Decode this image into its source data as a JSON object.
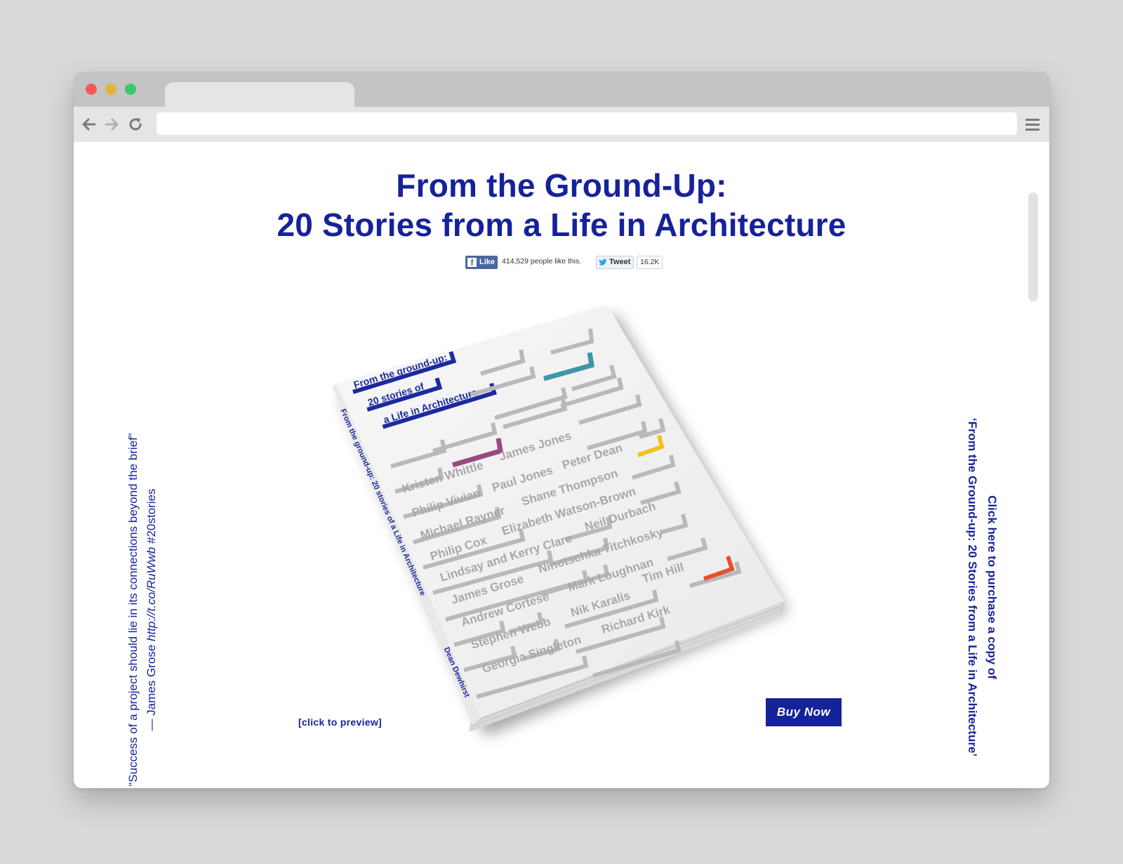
{
  "page": {
    "title_line1": "From the Ground-Up:",
    "title_line2": "20 Stories from a Life in Architecture"
  },
  "social": {
    "fb_label": "Like",
    "fb_count_text": "414,529 people like this.",
    "tweet_label": "Tweet",
    "tweet_count": "16.2K"
  },
  "quote": {
    "text": "“Success of a project should lie in its connections beyond the brief”",
    "attribution": "— James Grose",
    "link": "http://t.co/RuWwb",
    "hashtag": "#20stories"
  },
  "purchase": {
    "line1": "Click here to purchase a copy of",
    "line2": "‘From the Ground-up: 20 Stories from a Life in Architecture’"
  },
  "book": {
    "cover_title": [
      "From the ground-up:",
      "20 stories of",
      "a Life in Architecture"
    ],
    "names": [
      [
        "Kristen Whittle",
        "James Jones"
      ],
      [
        "Philip Vivian",
        "Paul Jones",
        "Peter Dean"
      ],
      [
        "Michael Rayner",
        "Shane Thompson"
      ],
      [
        "Philip Cox",
        "Elizabeth Watson-Brown"
      ],
      [
        "Lindsay and Kerry Clare",
        "Neil Durbach"
      ],
      [
        "James Grose",
        "Ninotschka Titchkosky"
      ],
      [
        "Andrew Cortese",
        "Mark Loughnan",
        "Tim Hill"
      ],
      [
        "Stephen Webb",
        "Nik Karalis"
      ],
      [
        "Georgia Singleton",
        "Richard Kirk"
      ]
    ],
    "spine_text": "From the ground-up: 20 stories of a Life in Architecture",
    "spine_author": "Dean Dewhirst",
    "accent_colors": [
      "#3c97aa",
      "#9a4a7f",
      "#f0c419",
      "#e5512b",
      "#1b2a9e"
    ]
  },
  "actions": {
    "preview": "[click to preview]",
    "buy": "Buy Now"
  },
  "colors": {
    "brand": "#16229a",
    "background": "#d9d9d7"
  }
}
